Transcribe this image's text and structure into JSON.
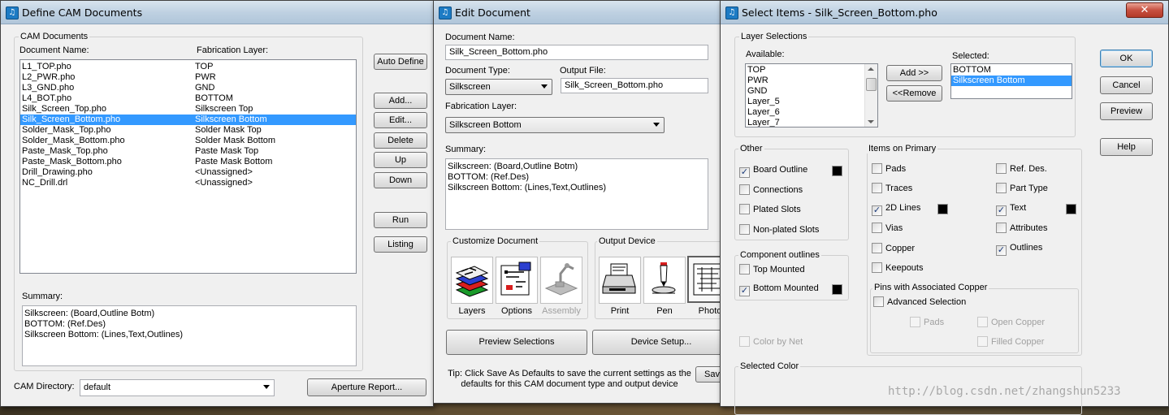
{
  "define_cam": {
    "title": "Define CAM Documents",
    "group_label": "CAM Documents",
    "col_name": "Document Name:",
    "col_layer": "Fabrication Layer:",
    "documents": [
      {
        "name": "L1_TOP.pho",
        "layer": "TOP"
      },
      {
        "name": "L2_PWR.pho",
        "layer": "PWR"
      },
      {
        "name": "L3_GND.pho",
        "layer": "GND"
      },
      {
        "name": "L4_BOT.pho",
        "layer": "BOTTOM"
      },
      {
        "name": "Silk_Screen_Top.pho",
        "layer": "Silkscreen Top"
      },
      {
        "name": "Silk_Screen_Bottom.pho",
        "layer": "Silkscreen Bottom"
      },
      {
        "name": "Solder_Mask_Top.pho",
        "layer": "Solder Mask Top"
      },
      {
        "name": "Solder_Mask_Bottom.pho",
        "layer": "Solder Mask Bottom"
      },
      {
        "name": "Paste_Mask_Top.pho",
        "layer": "Paste Mask Top"
      },
      {
        "name": "Paste_Mask_Bottom.pho",
        "layer": "Paste Mask Bottom"
      },
      {
        "name": "Drill_Drawing.pho",
        "layer": "<Unassigned>"
      },
      {
        "name": "NC_Drill.drl",
        "layer": "<Unassigned>"
      }
    ],
    "selected_index": 5,
    "buttons": {
      "auto_define": "Auto Define",
      "add": "Add...",
      "edit": "Edit...",
      "delete": "Delete",
      "up": "Up",
      "down": "Down",
      "run": "Run",
      "listing": "Listing",
      "aperture_report": "Aperture Report..."
    },
    "summary_label": "Summary:",
    "summary_lines": [
      "Silkscreen: (Board,Outline Botm)",
      "BOTTOM: (Ref.Des)",
      "Silkscreen Bottom: (Lines,Text,Outlines)"
    ],
    "cam_dir_label": "CAM Directory:",
    "cam_dir_value": "default"
  },
  "edit_doc": {
    "title": "Edit Document",
    "doc_name_label": "Document Name:",
    "doc_name_value": "Silk_Screen_Bottom.pho",
    "doc_type_label": "Document Type:",
    "doc_type_value": "Silkscreen",
    "output_file_label": "Output File:",
    "output_file_value": "Silk_Screen_Bottom.pho",
    "fab_layer_label": "Fabrication Layer:",
    "fab_layer_value": "Silkscreen Bottom",
    "summary_label": "Summary:",
    "summary_lines": [
      "Silkscreen: (Board,Outline Botm)",
      "BOTTOM: (Ref.Des)",
      "Silkscreen Bottom: (Lines,Text,Outlines)"
    ],
    "customize_label": "Customize Document",
    "customize_items": [
      "Layers",
      "Options",
      "Assembly"
    ],
    "output_device_label": "Output Device",
    "output_items": [
      "Print",
      "Pen",
      "Photo"
    ],
    "preview_button": "Preview Selections",
    "device_setup_button": "Device Setup...",
    "save_button": "Save",
    "tip": "Tip: Click Save As Defaults to save the current settings as the defaults for this CAM document type and output device"
  },
  "select_items": {
    "title": "Select Items - Silk_Screen_Bottom.pho",
    "close_glyph": "✕",
    "layer_selections_label": "Layer Selections",
    "available_label": "Available:",
    "available": [
      "TOP",
      "PWR",
      "GND",
      "Layer_5",
      "Layer_6",
      "Layer_7"
    ],
    "add_button": "Add >>",
    "remove_button": "<<Remove",
    "selected_label": "Selected:",
    "selected": [
      "BOTTOM",
      "Silkscreen Bottom"
    ],
    "selected_highlight_index": 1,
    "ok_button": "OK",
    "cancel_button": "Cancel",
    "preview_button": "Preview",
    "help_button": "Help",
    "other_label": "Other",
    "other_items": [
      {
        "label": "Board Outline",
        "checked": true
      },
      {
        "label": "Connections",
        "checked": false
      },
      {
        "label": "Plated Slots",
        "checked": false
      },
      {
        "label": "Non-plated Slots",
        "checked": false
      }
    ],
    "component_label": "Component outlines",
    "component_items": [
      {
        "label": "Top Mounted",
        "checked": false
      },
      {
        "label": "Bottom Mounted",
        "checked": true
      }
    ],
    "color_by_net": "Color by Net",
    "items_primary_label": "Items on Primary",
    "primary_left": [
      {
        "label": "Pads",
        "checked": false
      },
      {
        "label": "Traces",
        "checked": false
      },
      {
        "label": "2D Lines",
        "checked": true
      },
      {
        "label": "Vias",
        "checked": false
      },
      {
        "label": "Copper",
        "checked": false
      },
      {
        "label": "Keepouts",
        "checked": false
      }
    ],
    "primary_right": [
      {
        "label": "Ref. Des.",
        "checked": false
      },
      {
        "label": "Part Type",
        "checked": false
      },
      {
        "label": "Text",
        "checked": true
      },
      {
        "label": "Attributes",
        "checked": false
      },
      {
        "label": "Outlines",
        "checked": true
      }
    ],
    "pins_label": "Pins with Associated Copper",
    "advanced_selection": "Advanced Selection",
    "pins_pads": "Pads",
    "open_copper": "Open Copper",
    "filled_copper": "Filled Copper",
    "selected_color_label": "Selected Color",
    "swatch_color": "#000000"
  },
  "watermark": "http://blog.csdn.net/zhangshun5233"
}
